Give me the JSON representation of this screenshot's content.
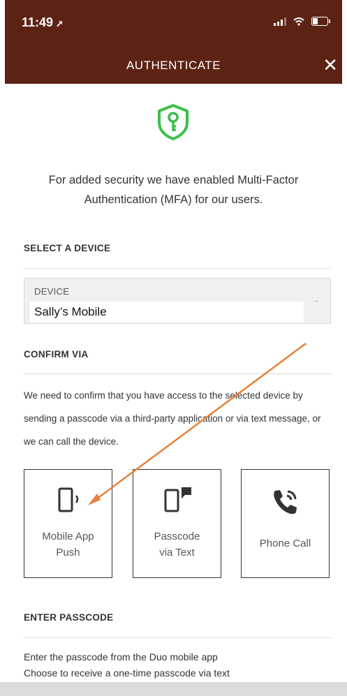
{
  "status_bar": {
    "time": "11:49",
    "location_icon": "location-arrow-icon"
  },
  "header": {
    "title": "AUTHENTICATE",
    "close_label": "✕"
  },
  "intro": {
    "text": "For added security we have enabled Multi-Factor Authentication (MFA) for our users."
  },
  "select_device": {
    "heading": "SELECT A DEVICE",
    "field_label": "DEVICE",
    "value": "Sally’s Mobile"
  },
  "confirm_via": {
    "heading": "CONFIRM VIA",
    "description": "We need to confirm that you have access to the selected device by sending a passcode via a third-party application or via text message, or we can call the device.",
    "options": [
      {
        "line1": "Mobile App",
        "line2": "Push",
        "icon": "mobile-push-icon"
      },
      {
        "line1": "Passcode",
        "line2": "via Text",
        "icon": "phone-message-icon"
      },
      {
        "line1": "Phone Call",
        "line2": "",
        "icon": "phone-call-icon"
      }
    ]
  },
  "enter_passcode": {
    "heading": "ENTER PASSCODE",
    "line1": "Enter the passcode from the Duo mobile app",
    "line2": "Choose to receive a one-time passcode via text"
  },
  "colors": {
    "header_bg": "#5c2314",
    "shield_green": "#3cbf4a",
    "annotation_arrow": "#e8803a"
  }
}
